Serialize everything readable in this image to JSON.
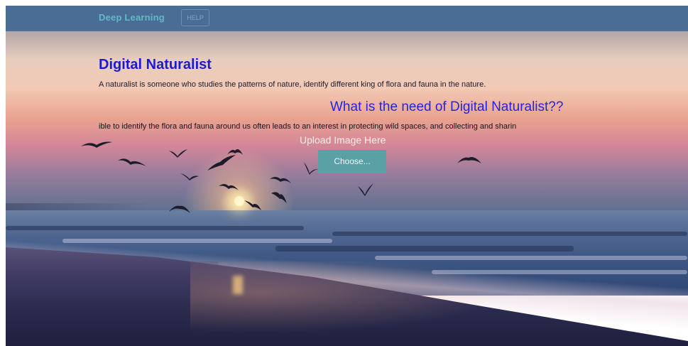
{
  "navbar": {
    "brand": "Deep Learning",
    "help_label": "HELP",
    "background": "#4a6d96"
  },
  "main": {
    "title": "Digital Naturalist",
    "intro": "A naturalist is someone who studies the patterns of nature, identify different king of flora and fauna in the nature.",
    "need_title": "What is the need of Digital Naturalist??",
    "need_text": "ible to identify the flora and fauna around us often leads to an interest in protecting wild spaces, and collecting and sharin",
    "upload_label": "Upload Image Here",
    "choose_label": "Choose..."
  },
  "background": {
    "scene": "sunset-beach-with-birds",
    "accent_color": "#5aa1a6",
    "title_color": "#1a1ad6"
  }
}
